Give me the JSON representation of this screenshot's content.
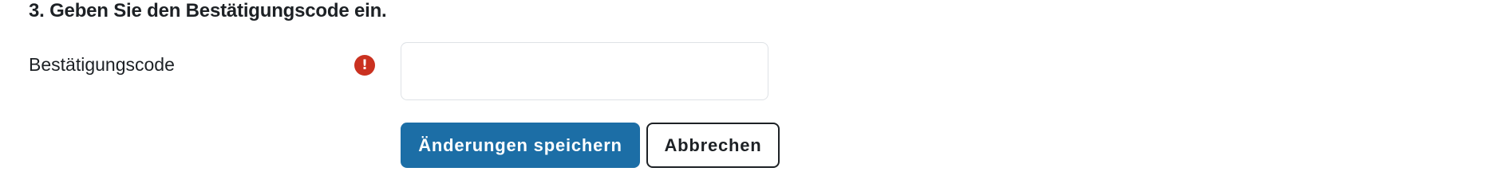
{
  "form": {
    "step_heading": "3. Geben Sie den Bestätigungscode ein.",
    "field": {
      "label": "Bestätigungscode",
      "value": "",
      "required_icon": "exclamation-icon"
    },
    "buttons": {
      "save_label": "Änderungen speichern",
      "cancel_label": "Abbrechen"
    }
  },
  "colors": {
    "primary": "#1c6ea6",
    "required": "#ca3120",
    "text": "#1d2125",
    "input_border": "#dee2e6"
  }
}
